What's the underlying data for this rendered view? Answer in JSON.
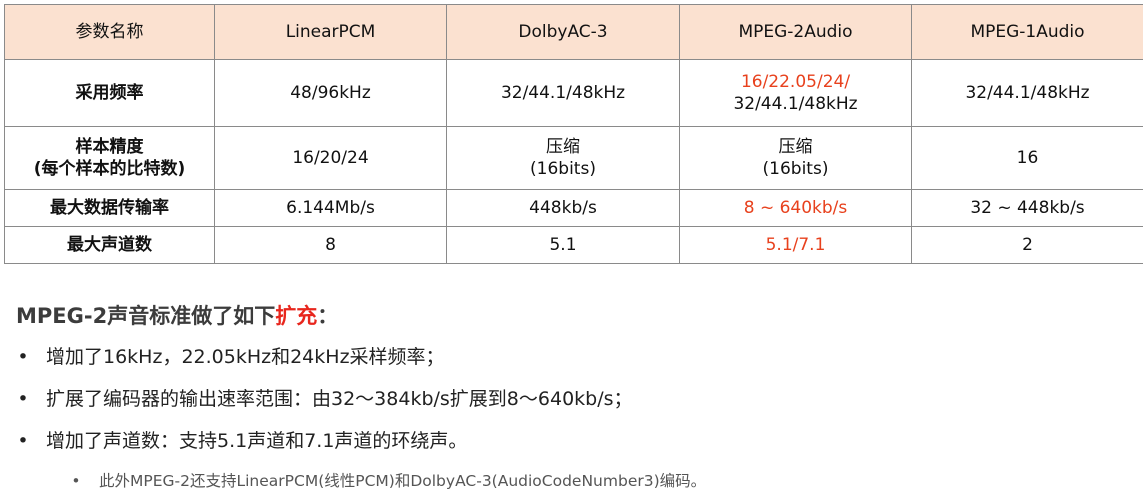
{
  "table": {
    "headers": [
      "参数名称",
      "LinearPCM",
      "DolbyAC-3",
      "MPEG-2Audio",
      "MPEG-1Audio"
    ],
    "rows": [
      {
        "label": [
          "采用频率"
        ],
        "cells": [
          [
            "48/96kHz"
          ],
          [
            "32/44.1/48kHz"
          ],
          [
            "16/22.05/24/",
            "32/44.1/48kHz"
          ],
          [
            "32/44.1/48kHz"
          ]
        ]
      },
      {
        "label": [
          "样本精度",
          "(每个样本的比特数)"
        ],
        "cells": [
          [
            "16/20/24"
          ],
          [
            "压缩",
            "(16bits)"
          ],
          [
            "压缩",
            "(16bits)"
          ],
          [
            "16"
          ]
        ]
      },
      {
        "label": [
          "最大数据传输率"
        ],
        "cells": [
          [
            "6.144Mb/s"
          ],
          [
            "448kb/s"
          ],
          [
            "8 ~ 640kb/s"
          ],
          [
            "32 ~ 448kb/s"
          ]
        ]
      },
      {
        "label": [
          "最大声道数"
        ],
        "cells": [
          [
            "8"
          ],
          [
            "5.1"
          ],
          [
            "5.1/7.1"
          ],
          [
            "2"
          ]
        ]
      }
    ],
    "highlight_color": "#e8411d",
    "header_background": "#fbe1d0"
  },
  "section": {
    "title_prefix": "MPEG-2声音标准做了如下",
    "title_accent": "扩充",
    "title_suffix": "：",
    "bullet": "•",
    "points": [
      "增加了16kHz，22.05kHz和24kHz采样频率；",
      "扩展了编码器的输出速率范围：由32～384kb/s扩展到8～640kb/s；",
      "增加了声道数：支持5.1声道和7.1声道的环绕声。"
    ],
    "subpoint": "此外MPEG-2还支持LinearPCM(线性PCM)和DolbyAC-3(AudioCodeNumber3)编码。",
    "accent_color": "#e8261d"
  }
}
